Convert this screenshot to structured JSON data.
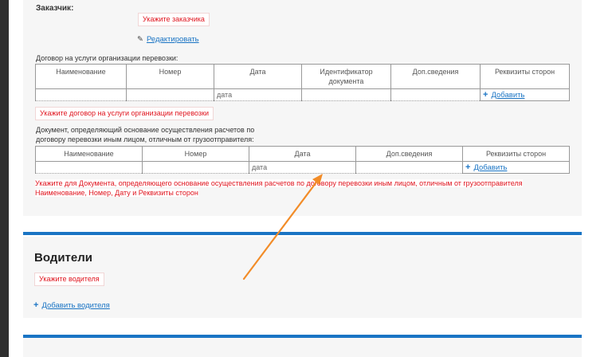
{
  "customer": {
    "label": "Заказчик:",
    "error": "Укажите заказчика",
    "edit_label": "Редактировать"
  },
  "contract": {
    "label": "Договор на услуги организации перевозки:",
    "columns": [
      "Наименование",
      "Номер",
      "Дата",
      "Идентификатор документа",
      "Доп.сведения",
      "Реквизиты сторон"
    ],
    "date_placeholder": "дата",
    "add_label": "Добавить",
    "error": "Укажите договор на услуги организации перевозки"
  },
  "basis_document": {
    "label_line1": "Документ, определяющий основание осуществления расчетов по",
    "label_line2": "договору перевозки иным лицом, отличным от грузоотправителя:",
    "columns": [
      "Наименование",
      "Номер",
      "Дата",
      "Доп.сведения",
      "Реквизиты сторон"
    ],
    "date_placeholder": "дата",
    "add_label": "Добавить",
    "error_line1": "Укажите для Документа, определяющего основание осуществления расчетов по договору перевозки иным лицом, отличным от грузоотправителя",
    "error_line2": "Наименование, Номер, Дату и Реквизиты сторон"
  },
  "drivers": {
    "title": "Водители",
    "error": "Укажите водителя",
    "add_label": "Добавить водителя"
  },
  "colors": {
    "accent": "#1a74c4",
    "error": "#e0141e",
    "annotation_arrow": "#f28c28"
  }
}
